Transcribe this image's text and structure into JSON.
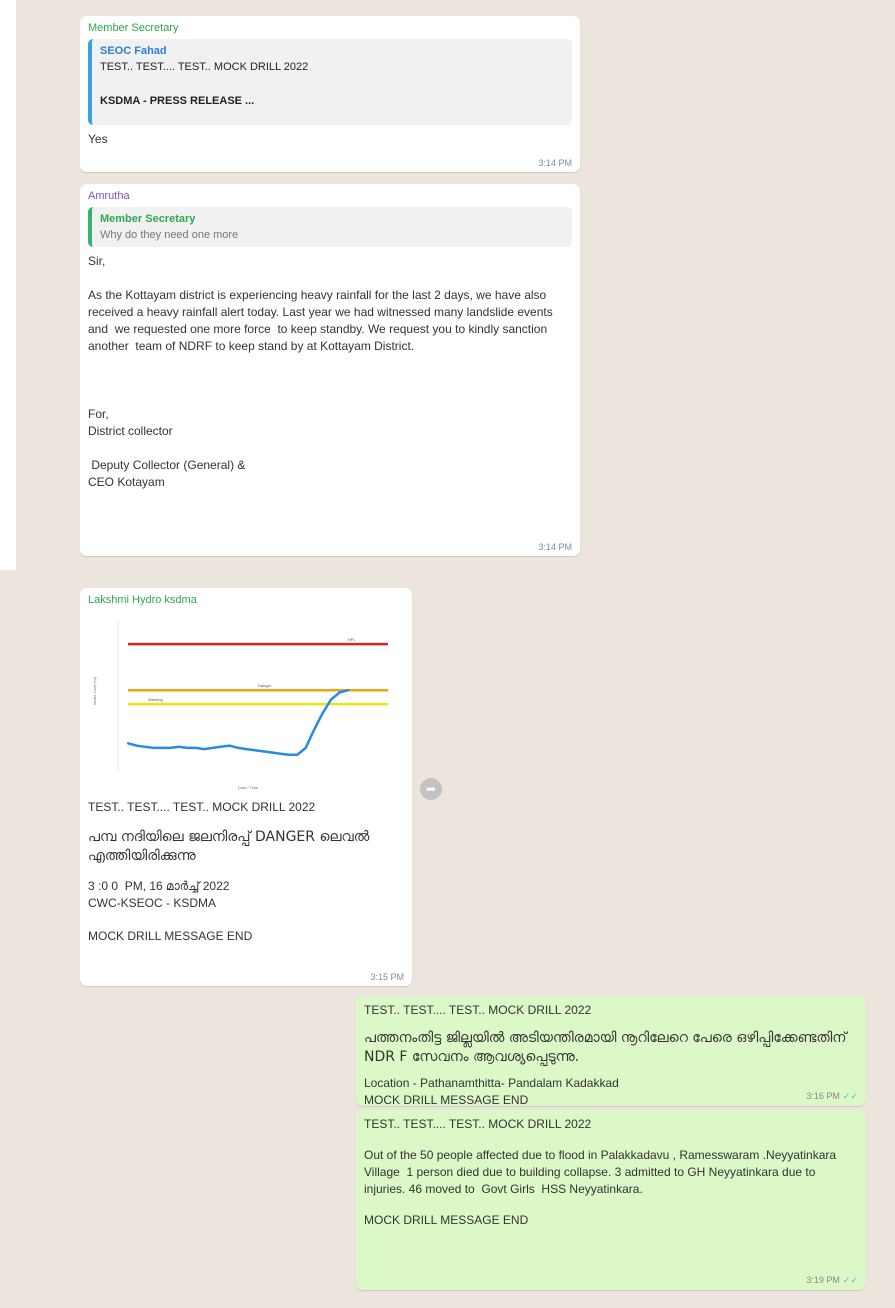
{
  "colors": {
    "chat_bg": "#ece5dd",
    "incoming": "#ffffff",
    "outgoing": "#dcf8c6",
    "sender_green": "#2fa84f",
    "sender_blue": "#2a80d8",
    "sender_purple": "#7b55c7",
    "ticks": "#4fb3e8"
  },
  "messages": [
    {
      "sender": "Member Secretary",
      "quote": {
        "name": "SEOC Fahad",
        "line1": "TEST.. TEST.... TEST.. MOCK DRILL 2022",
        "line2": "KSDMA - PRESS RELEASE ..."
      },
      "text": "Yes",
      "time": "3:14 PM"
    },
    {
      "sender": "Amrutha",
      "quote": {
        "name": "Member Secretary",
        "line1": "Why do they need one more"
      },
      "text": "Sir,\n\nAs the Kottayam district is experiencing heavy rainfall for the last 2 days, we have also  received a heavy rainfall alert today. Last year we had witnessed many landslide events and  we requested one more force  to keep standby. We request you to kindly sanction another  team of NDRF to keep stand by at Kottayam District.\n\n\n\nFor,\nDistrict collector\n\n Deputy Collector (General) &\nCEO Kotayam",
      "time": "3:14 PM"
    },
    {
      "sender": "Lakshmi Hydro ksdma",
      "line1": "TEST.. TEST.... TEST.. MOCK DRILL 2022",
      "mal": "പമ്പ നദിയിലെ ജലനിരപ്പ് DANGER ലെവൽ എത്തിയിരിക്കുന്നു",
      "line3": "3 :0 0  PM, 16 മാർച്ച് 2022\nCWC-KSEOC - KSDMA",
      "line4": "MOCK DRILL MESSAGE END",
      "time": "3:15 PM"
    },
    {
      "line1": "TEST.. TEST.... TEST.. MOCK DRILL 2022",
      "mal": "പത്തനംതിട്ട ജില്ലയിൽ അടിയന്തിരമായി നൂറിലേറെ പേരെ ഒഴിപ്പിക്കേണ്ടതിന്    NDR F സേവനം ആവശ്യപ്പെടുന്നു.",
      "line3": "Location - Pathanamthitta- Pandalam Kadakkad\nMOCK DRILL MESSAGE END",
      "time": "3:16 PM"
    },
    {
      "line1": "TEST.. TEST.... TEST.. MOCK DRILL 2022",
      "text": "Out of the 50 people affected due to flood in Palakkadavu , Ramesswaram .Neyyatinkara Village  1 person died due to building collapse. 3 admitted to GH Neyyatinkara due to injuries. 46 moved to  Govt Girls  HSS Neyyatinkara.",
      "line4": "MOCK DRILL MESSAGE END",
      "time": "3:19 PM"
    }
  ],
  "chart_data": {
    "type": "line",
    "title": "",
    "xlabel": "Date / Time",
    "ylabel": "Water Level (m)",
    "thresholds": [
      {
        "name": "HFL",
        "value": 9.0,
        "color": "#e02020"
      },
      {
        "name": "Danger",
        "value": 7.0,
        "color": "#e8a317"
      },
      {
        "name": "Warning",
        "value": 6.4,
        "color": "#e8e817"
      }
    ],
    "ylim": [
      3.5,
      10
    ],
    "series": [
      {
        "values": [
          4.7,
          4.6,
          4.55,
          4.5,
          4.5,
          4.5,
          4.55,
          4.5,
          4.5,
          4.45,
          4.5,
          4.55,
          4.6,
          4.5,
          4.45,
          4.4,
          4.35,
          4.3,
          4.25,
          4.2,
          4.2,
          4.5,
          5.3,
          6.0,
          6.6,
          6.9,
          7.0
        ],
        "color": "#2a8be0"
      }
    ]
  }
}
